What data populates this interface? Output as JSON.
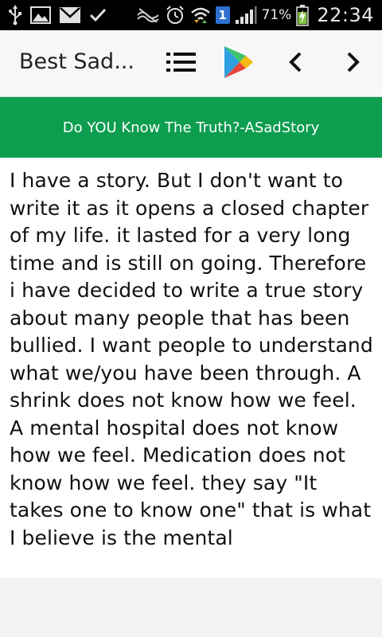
{
  "status_bar": {
    "battery_percent": "71%",
    "time": "22:34",
    "notification_badge": "1",
    "icons": [
      "usb-icon",
      "gallery-icon",
      "gmail-icon",
      "check-icon",
      "signal-muted-icon",
      "alarm-icon",
      "wifi-icon",
      "notification-badge-icon",
      "cell-signal-icon",
      "battery-charging-icon"
    ]
  },
  "toolbar": {
    "title": "Best Sad...",
    "icons": [
      "list-icon",
      "play-store-icon",
      "chevron-left-icon",
      "chevron-right-icon"
    ]
  },
  "banner": {
    "text": "Do YOU Know The Truth?-ASadStory"
  },
  "story": {
    "body": "I have a story. But I don't want to write it as it opens a closed chapter of my life. it lasted for a very long time and is still on going. Therefore i have decided to write a true story about many people that has been bullied. I want people to understand what we/you have been through. A shrink does not know how we feel. A mental hospital does not know how we feel. Medication does not know how we feel. they say \"It takes one to know one\" that is what I believe is the mental"
  },
  "colors": {
    "banner_bg": "#0d9d4f",
    "status_bar_bg": "#000000",
    "toolbar_bg": "#f7f7f7"
  }
}
